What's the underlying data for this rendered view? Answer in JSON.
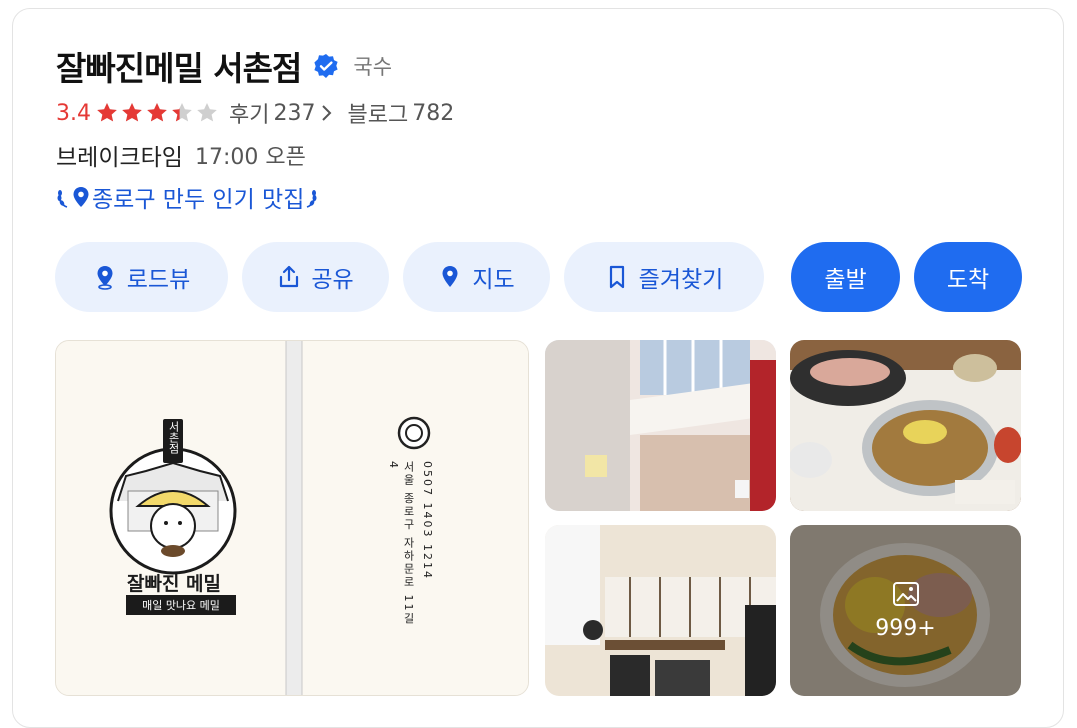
{
  "place": {
    "name": "잘빠진메밀 서촌점",
    "category": "국수"
  },
  "rating": {
    "score": "3.4",
    "stars_filled": 3.4,
    "stars_total": 5,
    "reviews_label": "후기",
    "reviews_count": "237",
    "blog_label": "블로그",
    "blog_count": "782"
  },
  "hours": {
    "status": "브레이크타임",
    "next": "17:00 오픈"
  },
  "award": {
    "text": "종로구 만두 인기 맛집"
  },
  "actions": {
    "roadview": "로드뷰",
    "share": "공유",
    "map": "지도",
    "bookmark": "즐겨찾기",
    "departure": "출발",
    "arrival": "도착"
  },
  "gallery": {
    "menu_card": {
      "branch_tag": "서촌점",
      "brand_name": "잘빠진 메밀",
      "slogan": "매일 맛나요 메밀",
      "phone": "0507 1403 1214",
      "address": "서울 종로구 자하문로 11길 4"
    },
    "more_count": "999+"
  },
  "colors": {
    "accent": "#1f6cf0",
    "accent_text": "#1a57d6",
    "pill_bg": "#eaf1fd",
    "rating": "#e53935",
    "star_filled": "#e53935",
    "star_empty": "#cfcfcf"
  },
  "icons": {
    "verified": "verified-check-icon",
    "roadview": "roadview-pin-icon",
    "share": "share-upload-icon",
    "map": "map-pin-icon",
    "bookmark": "bookmark-icon",
    "more_photos": "photo-gallery-icon"
  }
}
